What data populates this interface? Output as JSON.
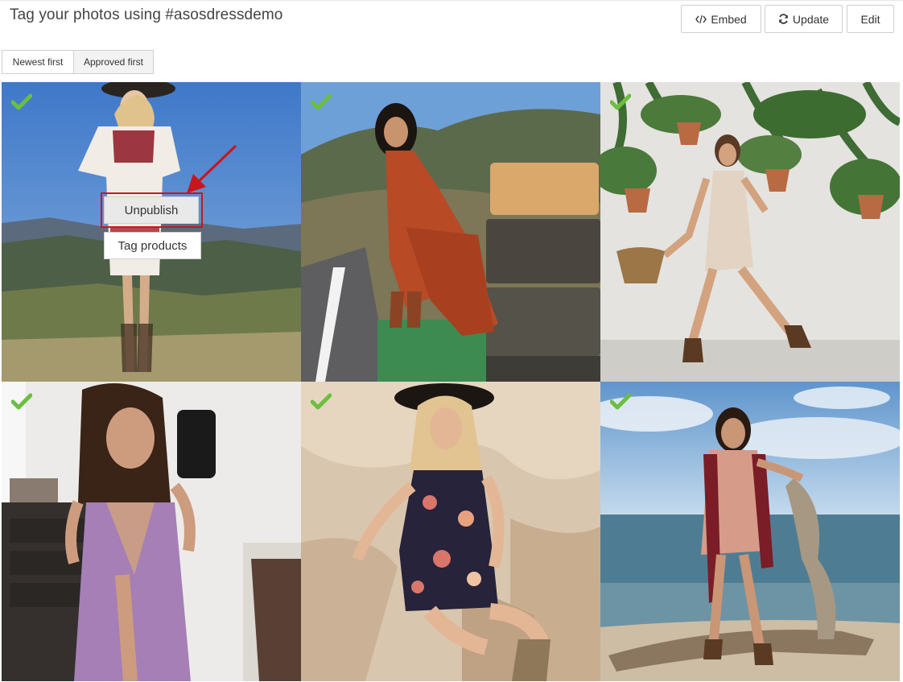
{
  "header": {
    "title": "Tag your photos using #asosdressdemo",
    "buttons": {
      "embed": {
        "icon": "code-icon",
        "label": "Embed"
      },
      "update": {
        "icon": "refresh-icon",
        "label": "Update"
      },
      "edit": {
        "label": "Edit"
      }
    }
  },
  "sort": {
    "options": [
      "Newest first",
      "Approved first"
    ],
    "selected": "Approved first"
  },
  "grid": {
    "tiles": [
      {
        "approved": true,
        "icon": "check-icon",
        "scene": "woman in hat and embroidered dress on hillside"
      },
      {
        "approved": true,
        "icon": "check-icon",
        "scene": "woman in red fringe dress on stacked suitcases"
      },
      {
        "approved": true,
        "icon": "check-icon",
        "scene": "woman in beige dress with plants on wall"
      },
      {
        "approved": true,
        "icon": "check-icon",
        "scene": "woman in lavender dress taking mirror selfie"
      },
      {
        "approved": true,
        "icon": "check-icon",
        "scene": "woman in floral romper against rock"
      },
      {
        "approved": true,
        "icon": "check-icon",
        "scene": "woman in lace dress on beach driftwood"
      }
    ]
  },
  "context_menu": {
    "unpublish": "Unpublish",
    "tag_products": "Tag products"
  },
  "colors": {
    "check": "#6abf3f",
    "highlight": "#c8161d",
    "arrow": "#c8161d"
  }
}
